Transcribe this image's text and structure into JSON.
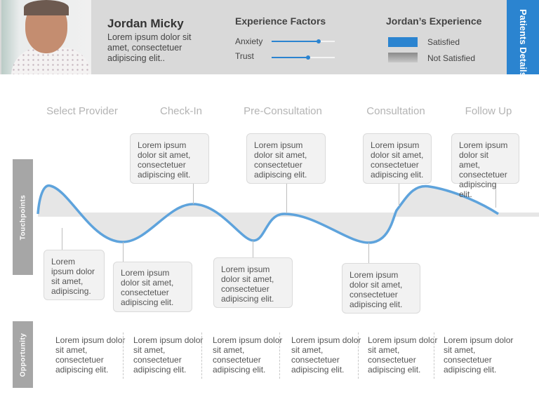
{
  "header": {
    "name": "Jordan Micky",
    "description": "Lorem ipsum dolor sit amet, consectetuer adipiscing elit..",
    "factors_title": "Experience Factors",
    "factors": [
      {
        "label": "Anxiety",
        "value_percent": 75
      },
      {
        "label": "Trust",
        "value_percent": 58
      }
    ],
    "experience_title": "Jordan’s Experience",
    "legend": [
      {
        "label": "Satisfied",
        "color": "#2b84d0"
      },
      {
        "label": "Not Satisfied",
        "color": "#9a9a9a"
      }
    ],
    "tab_label": "Patients Details"
  },
  "stages": [
    "Select Provider",
    "Check-In",
    "Pre-Consultation",
    "Consultation",
    "Follow Up"
  ],
  "touchpoints_label": "Touchpoints",
  "opportunity_label": "Opportunity",
  "callouts_top": [
    "Lorem ipsum dolor sit amet, consectetuer adipiscing elit.",
    "Lorem ipsum dolor sit amet, consectetuer adipiscing elit.",
    "Lorem ipsum dolor sit amet, consectetuer adipiscing elit.",
    "Lorem ipsum dolor sit amet, consectetuer adipiscing elit."
  ],
  "callouts_bottom": [
    "Lorem ipsum dolor sit amet, adipiscing.",
    "Lorem ipsum dolor sit amet, consectetuer adipiscing elit.",
    "Lorem ipsum dolor sit amet, consectetuer adipiscing elit.",
    "Lorem ipsum dolor sit amet, consectetuer adipiscing elit."
  ],
  "opportunities": [
    "Lorem ipsum dolor sit amet, consectetuer adipiscing elit.",
    "Lorem ipsum dolor sit amet, consectetuer adipiscing elit.",
    "Lorem ipsum dolor sit amet, consectetuer adipiscing elit.",
    "Lorem ipsum dolor sit amet, consectetuer adipiscing elit.",
    "Lorem ipsum dolor sit amet, consectetuer adipiscing elit.",
    "Lorem ipsum dolor sit amet, consectetuer adipiscing elit."
  ],
  "colors": {
    "accent": "#2b84d0",
    "curve": "#5ea3dc",
    "band": "#e6e6e6"
  }
}
